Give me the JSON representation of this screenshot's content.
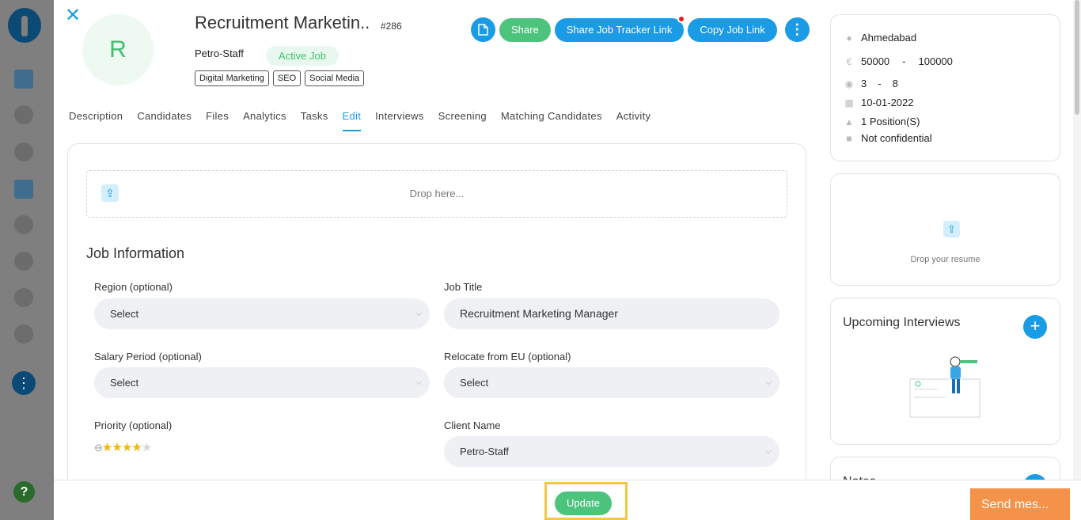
{
  "job": {
    "avatar_letter": "R",
    "title": "Recruitment Marketin..",
    "id": "#286",
    "client": "Petro-Staff",
    "status": "Active Job",
    "tags": [
      "Digital Marketing",
      "SEO",
      "Social Media"
    ]
  },
  "actions": {
    "share": "Share",
    "share_tracker": "Share Job Tracker Link",
    "copy_link": "Copy Job Link"
  },
  "tabs": [
    {
      "label": "Description"
    },
    {
      "label": "Candidates"
    },
    {
      "label": "Files"
    },
    {
      "label": "Analytics"
    },
    {
      "label": "Tasks"
    },
    {
      "label": "Edit",
      "active": true
    },
    {
      "label": "Interviews"
    },
    {
      "label": "Screening"
    },
    {
      "label": "Matching Candidates"
    },
    {
      "label": "Activity"
    }
  ],
  "form": {
    "drop_text": "Drop here...",
    "section_title": "Job Information",
    "region_label": "Region (optional)",
    "region_value": "Select",
    "job_title_label": "Job Title",
    "job_title_value": "Recruitment Marketing Manager",
    "salary_period_label": "Salary Period (optional)",
    "salary_period_value": "Select",
    "relocate_label": "Relocate from EU (optional)",
    "relocate_value": "Select",
    "priority_label": "Priority (optional)",
    "priority_stars": 4,
    "priority_max": 5,
    "client_name_label": "Client Name",
    "client_name_value": "Petro-Staff"
  },
  "info": {
    "location": "Ahmedabad",
    "currency_symbol": "€",
    "salary_min": "50000",
    "salary_sep": "-",
    "salary_max": "100000",
    "exp_min": "3",
    "exp_sep": "-",
    "exp_max": "8",
    "date": "10-01-2022",
    "positions": "1 Position(S)",
    "confidentiality": "Not confidential"
  },
  "resume": {
    "drop_text": "Drop your resume"
  },
  "interviews": {
    "title": "Upcoming Interviews"
  },
  "notes": {
    "title": "Notes"
  },
  "bottom": {
    "update": "Update",
    "send": "Send mes..."
  },
  "colors": {
    "accent": "#1a9be6",
    "success": "#4cc47d",
    "highlight": "#f3c744",
    "send": "#f4924a"
  }
}
